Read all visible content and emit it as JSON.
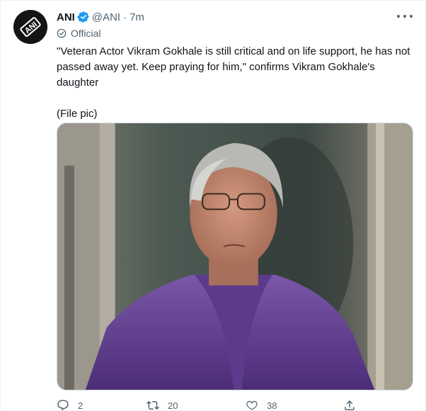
{
  "author": {
    "name": "ANI",
    "handle": "@ANI",
    "separator": "·",
    "time": "7m",
    "official_label": "Official",
    "avatar_text": "ANI"
  },
  "tweet": {
    "text": "\"Veteran Actor Vikram Gokhale is still critical and on life support, he has not passed away yet. Keep praying for him,\" confirms Vikram Gokhale's daughter",
    "file_note": "(File pic)"
  },
  "actions": {
    "replies": "2",
    "retweets": "20",
    "likes": "38"
  },
  "colors": {
    "verified_blue": "#1d9bf0",
    "secondary_text": "#536471",
    "primary_text": "#0f1419"
  },
  "icons": [
    "verified-badge-icon",
    "more-icon",
    "official-icon",
    "reply-icon",
    "retweet-icon",
    "like-icon",
    "share-icon"
  ]
}
